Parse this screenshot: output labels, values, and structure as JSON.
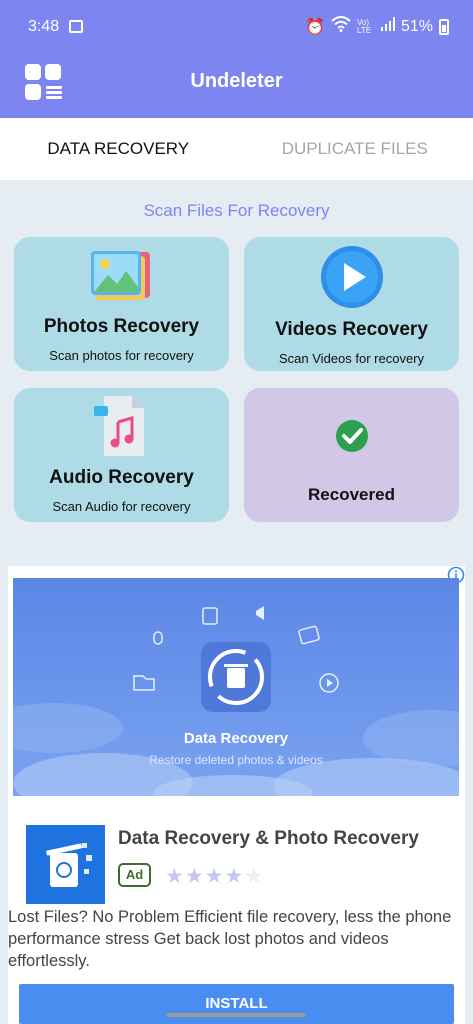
{
  "status_bar": {
    "time": "3:48",
    "network": "Vo) LTE",
    "battery": "51%"
  },
  "app_bar": {
    "title": "Undeleter"
  },
  "tabs": [
    {
      "label": "DATA RECOVERY",
      "active": true
    },
    {
      "label": "DUPLICATE FILES",
      "active": false
    }
  ],
  "section_title": "Scan Files For Recovery",
  "cards": {
    "photos": {
      "title": "Photos Recovery",
      "subtitle": "Scan photos for recovery"
    },
    "videos": {
      "title": "Videos Recovery",
      "subtitle": "Scan Videos for recovery"
    },
    "audio": {
      "title": "Audio Recovery",
      "subtitle": "Scan Audio for recovery"
    },
    "recovered": {
      "title": "Recovered"
    }
  },
  "ad": {
    "banner_title": "Data Recovery",
    "banner_subtitle": "Restore deleted photos & videos",
    "app_title": "Data Recovery & Photo Recovery",
    "badge": "Ad",
    "rating": 4,
    "description": "Lost Files? No Problem Efficient file recovery, less the phone performance stress Get back lost photos and videos effortlessly.",
    "install_label": "INSTALL"
  },
  "colors": {
    "accent": "#7d86f0",
    "card_blue": "#aedbe6",
    "card_purple": "#d0c8e6",
    "check_green": "#2e9e4f",
    "install_blue": "#4a8df0"
  }
}
